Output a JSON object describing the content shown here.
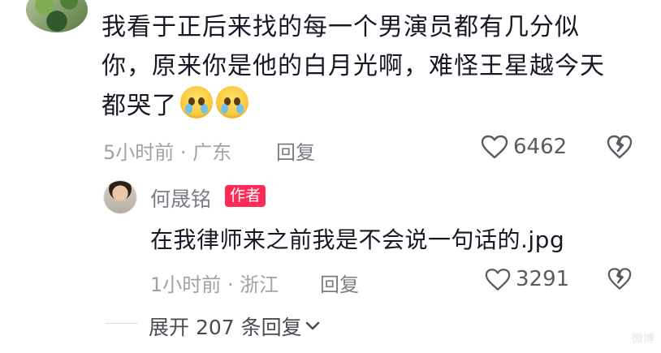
{
  "comment": {
    "text_line1": "我看于正后来找的每一个男演员都有几分似",
    "text_line2": "你，原来你是他的白月光啊，难怪王星越今天",
    "text_line3": "都哭了",
    "emoji": "pleading-crying-face",
    "meta": "5小时前 · 广东",
    "reply_label": "回复",
    "likes": "6462"
  },
  "reply": {
    "author": "何晟铭",
    "badge": "作者",
    "text": "在我律师来之前我是不会说一句话的.jpg",
    "meta": "1小时前 · 浙江",
    "reply_label": "回复",
    "likes": "3291"
  },
  "expand_label": "展开 207 条回复",
  "watermark": "微博"
}
